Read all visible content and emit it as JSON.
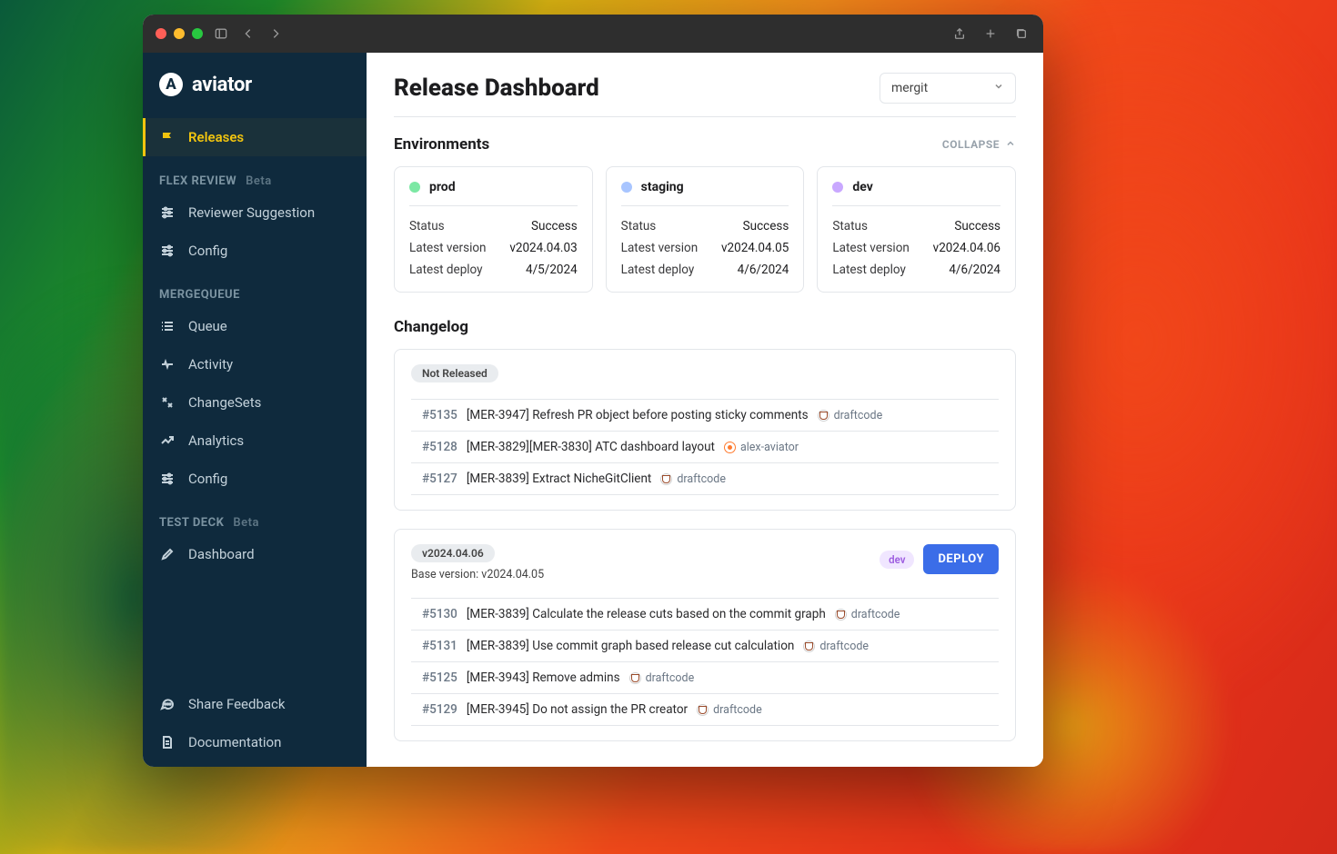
{
  "brand": {
    "name": "aviator",
    "icon_letter": "A"
  },
  "sidebar": {
    "top": {
      "label": "Releases"
    },
    "sections": [
      {
        "title": "FLEX REVIEW",
        "tag": "Beta",
        "items": [
          {
            "label": "Reviewer Suggestion"
          },
          {
            "label": "Config"
          }
        ]
      },
      {
        "title": "MERGEQUEUE",
        "tag": "",
        "items": [
          {
            "label": "Queue"
          },
          {
            "label": "Activity"
          },
          {
            "label": "ChangeSets"
          },
          {
            "label": "Analytics"
          },
          {
            "label": "Config"
          }
        ]
      },
      {
        "title": "TEST DECK",
        "tag": "Beta",
        "items": [
          {
            "label": "Dashboard"
          }
        ]
      }
    ],
    "bottom": [
      {
        "label": "Share Feedback"
      },
      {
        "label": "Documentation"
      }
    ]
  },
  "page": {
    "title": "Release Dashboard",
    "repo_select": "mergit",
    "env_section": {
      "title": "Environments",
      "collapse": "COLLAPSE"
    },
    "environments": [
      {
        "name": "prod",
        "color": "#7ce8a4",
        "status_label": "Status",
        "status": "Success",
        "ver_label": "Latest version",
        "version": "v2024.04.03",
        "dep_label": "Latest deploy",
        "deploy": "4/5/2024"
      },
      {
        "name": "staging",
        "color": "#a8c5ff",
        "status_label": "Status",
        "status": "Success",
        "ver_label": "Latest version",
        "version": "v2024.04.05",
        "dep_label": "Latest deploy",
        "deploy": "4/6/2024"
      },
      {
        "name": "dev",
        "color": "#c9a8ff",
        "status_label": "Status",
        "status": "Success",
        "ver_label": "Latest version",
        "version": "v2024.04.06",
        "dep_label": "Latest deploy",
        "deploy": "4/6/2024"
      }
    ],
    "changelog_title": "Changelog",
    "groups": [
      {
        "badge": "Not Released",
        "base": "",
        "env": "",
        "deploy": "",
        "prs": [
          {
            "id": "#5135",
            "title": "[MER-3947] Refresh PR object before posting sticky comments",
            "author": "draftcode",
            "av": "cup"
          },
          {
            "id": "#5128",
            "title": "[MER-3829][MER-3830] ATC dashboard layout",
            "author": "alex-aviator",
            "av": "orange"
          },
          {
            "id": "#5127",
            "title": "[MER-3839] Extract NicheGitClient",
            "author": "draftcode",
            "av": "cup"
          }
        ]
      },
      {
        "badge": "v2024.04.06",
        "base": "Base version: v2024.04.05",
        "env": "dev",
        "deploy": "DEPLOY",
        "prs": [
          {
            "id": "#5130",
            "title": "[MER-3839] Calculate the release cuts based on the commit graph",
            "author": "draftcode",
            "av": "cup"
          },
          {
            "id": "#5131",
            "title": "[MER-3839] Use commit graph based release cut calculation",
            "author": "draftcode",
            "av": "cup"
          },
          {
            "id": "#5125",
            "title": "[MER-3943] Remove admins",
            "author": "draftcode",
            "av": "cup"
          },
          {
            "id": "#5129",
            "title": "[MER-3945] Do not assign the PR creator",
            "author": "draftcode",
            "av": "cup"
          }
        ]
      }
    ]
  }
}
